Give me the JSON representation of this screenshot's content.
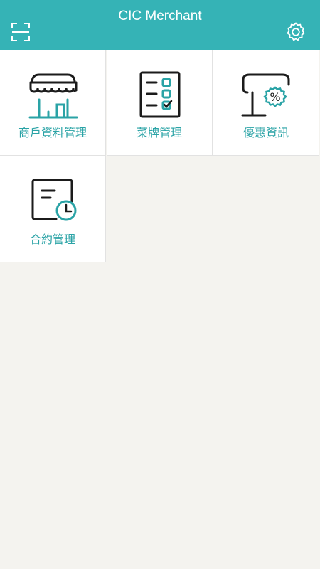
{
  "header": {
    "title": "CIC Merchant",
    "background": "#35b3b6",
    "left_icon": "scan-icon",
    "right_icon": "gear-icon"
  },
  "menu": {
    "items": [
      {
        "label": "商戶資料管理",
        "icon": "storefront-icon"
      },
      {
        "label": "菜牌管理",
        "icon": "menu-checklist-icon"
      },
      {
        "label": "優惠資訊",
        "icon": "store-discount-icon"
      },
      {
        "label": "合約管理",
        "icon": "contract-clock-icon"
      }
    ]
  },
  "colors": {
    "accent": "#35b3b6",
    "label_text": "#2aa3a6",
    "icon_dark": "#1b1b1b",
    "page_background": "#f4f3ef"
  }
}
